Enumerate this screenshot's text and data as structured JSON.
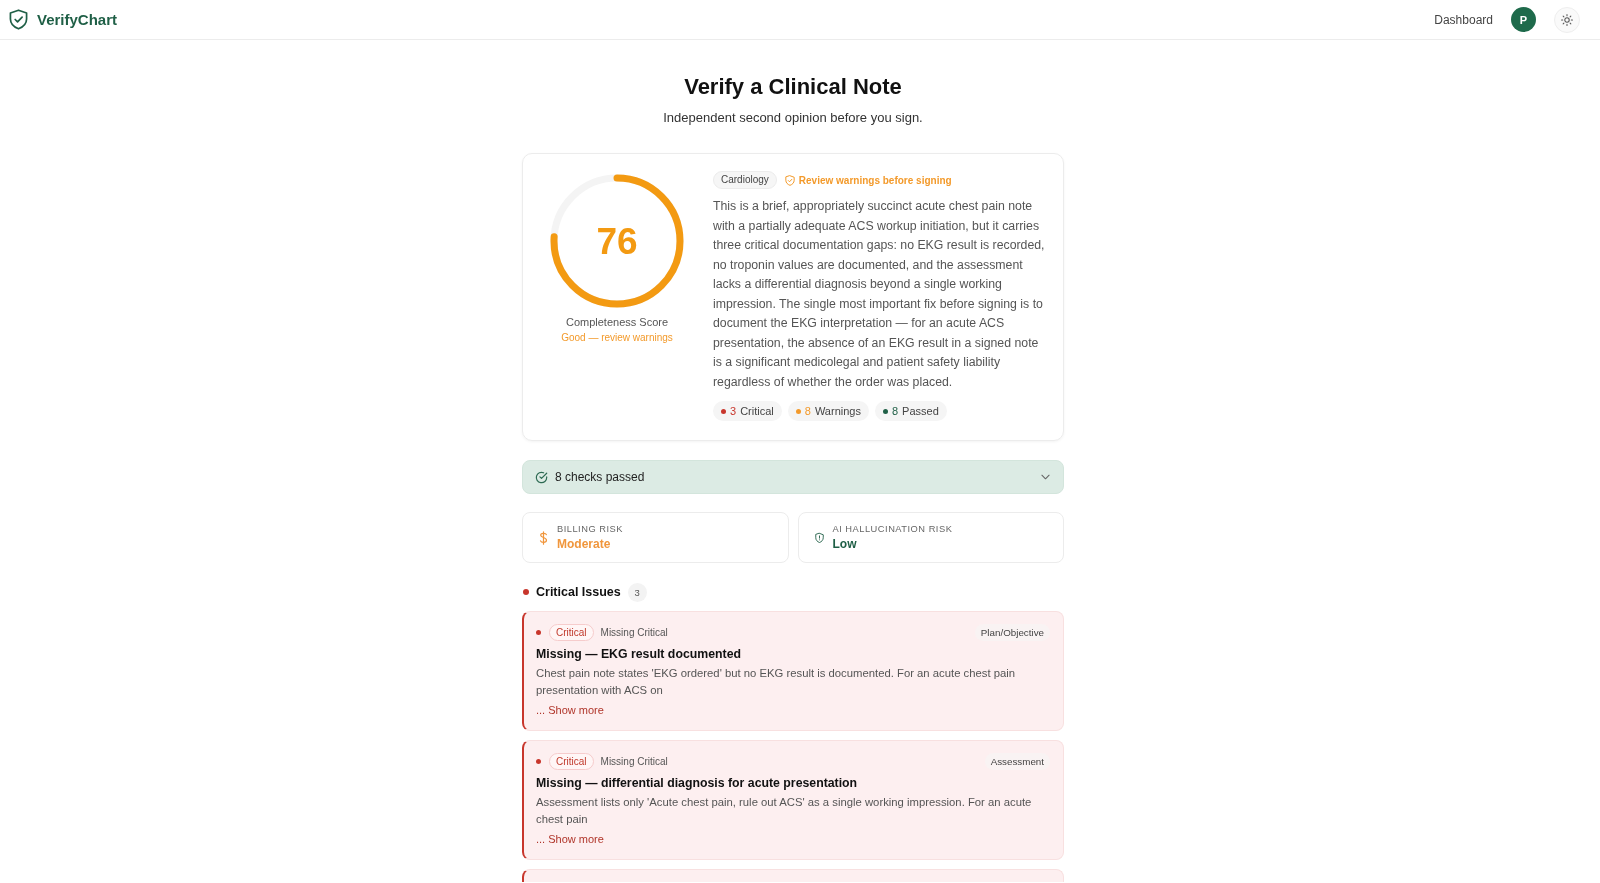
{
  "header": {
    "brand": "VerifyChart",
    "nav_link": "Dashboard",
    "avatar_initial": "P"
  },
  "page": {
    "title": "Verify a Clinical Note",
    "subtitle": "Independent second opinion before you sign."
  },
  "score_card": {
    "score": "76",
    "level": 0.76,
    "label": "Completeness Score",
    "verdict": "Good — review warnings",
    "specialty": "Cardiology",
    "alert": "Review warnings before signing",
    "summary": "This is a brief, appropriately succinct acute chest pain note with a partially adequate ACS workup initiation, but it carries three critical documentation gaps: no EKG result is recorded, no troponin values are documented, and the assessment lacks a differential diagnosis beyond a single working impression. The single most important fix before signing is to document the EKG interpretation — for an acute ACS presentation, the absence of an EKG result in a signed note is a significant medicolegal and patient safety liability regardless of whether the order was placed.",
    "stats": [
      {
        "count": "3",
        "label": "Critical",
        "color": "#c8362c"
      },
      {
        "count": "8",
        "label": "Warnings",
        "color": "#f39a2b"
      },
      {
        "count": "8",
        "label": "Passed",
        "color": "#1f5f46"
      }
    ]
  },
  "checks_bar": {
    "label": "8 checks passed",
    "expanded": false
  },
  "risks": [
    {
      "kind": "billing",
      "label": "BILLING RISK",
      "value": "Moderate",
      "color": "#f0963c"
    },
    {
      "kind": "hallucination",
      "label": "AI HALLUCINATION RISK",
      "value": "Low",
      "color": "#1f5f46"
    }
  ],
  "critical_issues": {
    "title": "Critical Issues",
    "count": "3",
    "items": [
      {
        "severity": "Critical",
        "category": "Missing Critical",
        "section": "Plan/Objective",
        "title": "Missing — EKG result documented",
        "description": "Chest pain note states 'EKG ordered' but no EKG result is documented. For an acute chest pain presentation with ACS on",
        "show_more": "... Show more"
      },
      {
        "severity": "Critical",
        "category": "Missing Critical",
        "section": "Assessment",
        "title": "Missing — differential diagnosis for acute presentation",
        "description": "Assessment lists only 'Acute chest pain, rule out ACS' as a single working impression. For an acute chest pain",
        "show_more": "... Show more"
      }
    ]
  }
}
